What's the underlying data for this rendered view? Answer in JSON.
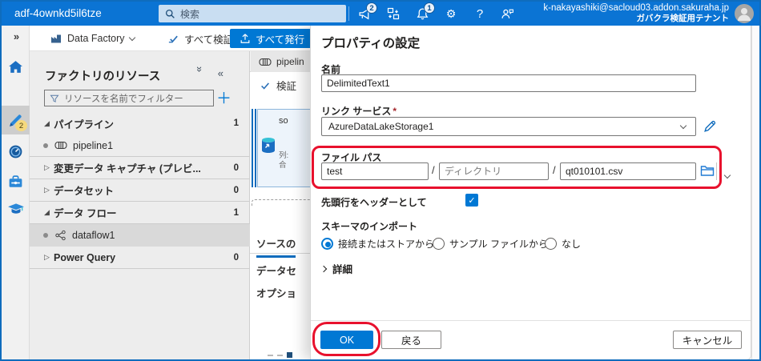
{
  "colors": {
    "accent": "#0078d4",
    "annotation": "#e8112d"
  },
  "topbar": {
    "app_name": "adf-4ownkd5il6tze",
    "search_placeholder": "検索",
    "announcement_badge": "2",
    "notification_badge": "1",
    "account_email": "k-nakayashiki@sacloud03.addon.sakuraha.jp",
    "account_tenant": "ガバクラ検証用テナント"
  },
  "rail": {
    "edit_badge": "2"
  },
  "toolbar": {
    "factory": "Data Factory",
    "validate_all": "すべて検証",
    "publish_all": "すべて発行"
  },
  "sidebar": {
    "title": "ファクトリのリソース",
    "filter_placeholder": "リソースを名前でフィルター",
    "tree": [
      {
        "label": "パイプライン",
        "count": "1"
      },
      {
        "label": "pipeline1"
      },
      {
        "label": "変更データ キャプチャ (プレビ...",
        "count": "0"
      },
      {
        "label": "データセット",
        "count": "0"
      },
      {
        "label": "データ フロー",
        "count": "1"
      },
      {
        "label": "dataflow1"
      },
      {
        "label": "Power Query",
        "count": "0"
      }
    ]
  },
  "canvas": {
    "tab": "pipelin",
    "validate": "検証",
    "node_title": "so",
    "node_meta1": "列:",
    "node_meta2": "合",
    "tab_source": "ソースの",
    "row_dataset": "データセ",
    "row_options": "オプショ"
  },
  "panel": {
    "title": "プロパティの設定",
    "name_label": "名前",
    "name_value": "DelimitedText1",
    "linked_service_label": "リンク サービス",
    "required": "*",
    "linked_service_value": "AzureDataLakeStorage1",
    "file_path_label": "ファイル パス",
    "path_sep": "/",
    "container_value": "test",
    "directory_placeholder": "ディレクトリ",
    "file_value": "qt010101.csv",
    "header_label": "先頭行をヘッダーとして",
    "schema_label": "スキーマのインポート",
    "schema_options": [
      {
        "label": "接続またはストアから"
      },
      {
        "label": "サンプル ファイルから"
      },
      {
        "label": "なし"
      }
    ],
    "details": "詳細",
    "ok": "OK",
    "back": "戻る",
    "cancel": "キャンセル"
  }
}
